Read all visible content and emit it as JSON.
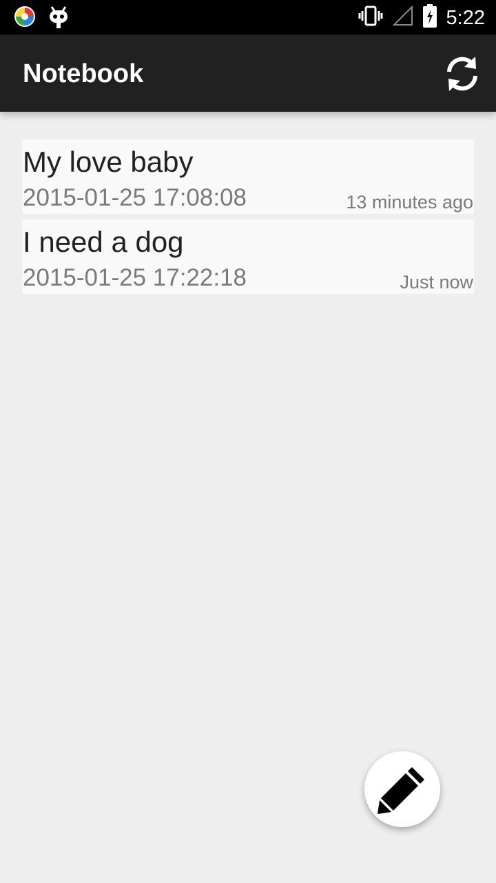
{
  "status_bar": {
    "time": "5:22",
    "left_icons": [
      "app-launcher-icon",
      "cyanogen-mascot-icon"
    ],
    "right_icons": [
      "vibrate-icon",
      "no-signal-icon",
      "battery-charging-icon"
    ]
  },
  "app_bar": {
    "title": "Notebook",
    "action_icon": "refresh-icon"
  },
  "notes": [
    {
      "title": "My love baby",
      "date": "2015-01-25 17:08:08",
      "relative": "13 minutes ago"
    },
    {
      "title": "I need a dog",
      "date": "2015-01-25 17:22:18",
      "relative": "Just now"
    }
  ],
  "fab": {
    "icon": "pencil-icon"
  },
  "colors": {
    "app_bar": "#212121",
    "background": "#eeeeee",
    "card": "#f9f9f9"
  }
}
